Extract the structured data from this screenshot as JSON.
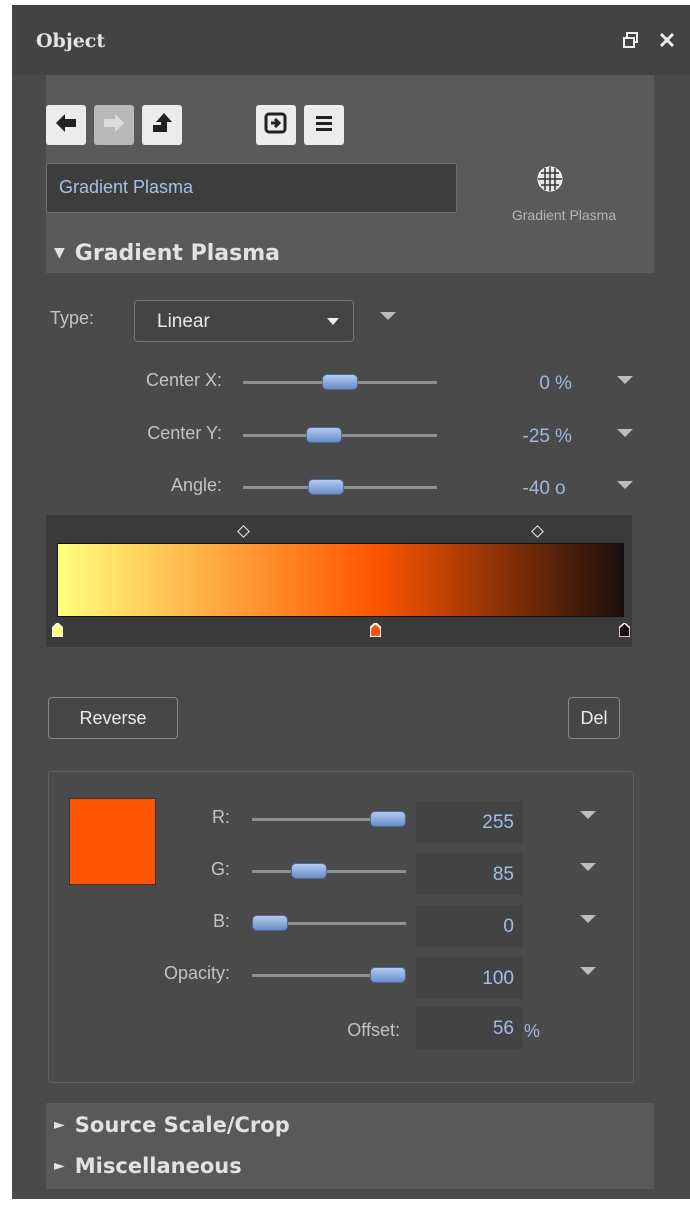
{
  "window": {
    "title": "Object",
    "icons": [
      "restore-icon",
      "close-icon"
    ]
  },
  "toolbar": {
    "icons": [
      "back-arrow-icon",
      "forward-arrow-icon",
      "up-arrow-icon",
      "export-icon",
      "list-icon"
    ]
  },
  "object": {
    "name_value": "Gradient Plasma",
    "icon": "globe-grid-icon",
    "icon_label": "Gradient Plasma"
  },
  "sections": {
    "gradient": "Gradient Plasma",
    "source": "Source Scale/Crop",
    "misc": "Miscellaneous"
  },
  "type": {
    "label": "Type:",
    "value": "Linear"
  },
  "params": [
    {
      "label": "Center X:",
      "value": "0",
      "unit": "%",
      "slider": 0.5
    },
    {
      "label": "Center Y:",
      "value": "-25",
      "unit": "%",
      "slider": 0.4
    },
    {
      "label": "Angle:",
      "value": "-40",
      "unit": "o",
      "slider": 0.41
    }
  ],
  "gradient": {
    "colors": [
      "#ffff80",
      "#ff5500",
      "#1a0f0c"
    ],
    "stops": [
      0,
      0.56,
      1
    ],
    "selected_stop": 1
  },
  "buttons": {
    "reverse": "Reverse",
    "delete": "Del"
  },
  "color": {
    "swatch": "#ff5500",
    "channels": [
      {
        "label": "R:",
        "value": "255",
        "fraction": 1.0
      },
      {
        "label": "G:",
        "value": "85",
        "fraction": 0.33
      },
      {
        "label": "B:",
        "value": "0",
        "fraction": 0.0
      },
      {
        "label": "Opacity:",
        "value": "100",
        "fraction": 1.0
      }
    ],
    "offset": {
      "label": "Offset:",
      "value": "56",
      "unit": "%"
    }
  }
}
